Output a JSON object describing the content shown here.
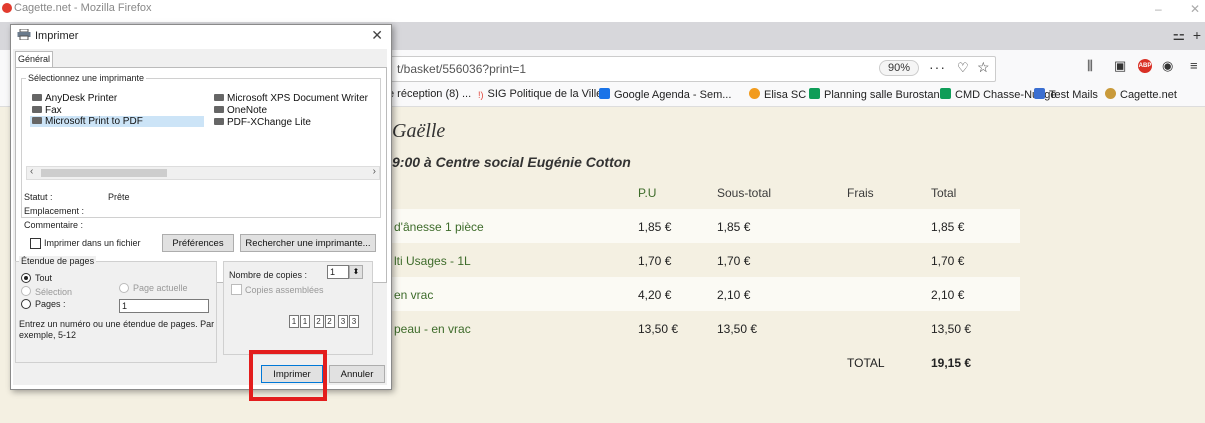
{
  "window": {
    "title": "Cagette.net - Mozilla Firefox"
  },
  "browser": {
    "url": "t/basket/556036?print=1",
    "zoom": "90%",
    "more": "···",
    "bookmarks": [
      {
        "label": "e réception (8) ...",
        "color": "#ffffff"
      },
      {
        "label": "SIG Politique de la Ville",
        "color": "#e0443a"
      },
      {
        "label": "Google Agenda - Sem...",
        "color": "#1a73e8"
      },
      {
        "label": "Elisa SC",
        "color": "#f29b1d"
      },
      {
        "label": "Planning salle Burostan",
        "color": "#0f9d58"
      },
      {
        "label": "CMD Chasse-Nuage",
        "color": "#0f9d58"
      },
      {
        "label": "Test Mails",
        "color": "#3b6fd1"
      },
      {
        "label": "Cagette.net",
        "color": "#c99a3a"
      }
    ]
  },
  "page": {
    "name": "Gaëlle",
    "slot": "9:00 à Centre social Eugénie Cotton",
    "table": {
      "headers": {
        "pu": "P.U",
        "subtotal": "Sous-total",
        "fees": "Frais",
        "total": "Total"
      },
      "rows": [
        {
          "product": "d'ânesse 1 pièce",
          "pu": "1,85 €",
          "subtotal": "1,85 €",
          "fees": "",
          "total": "1,85 €"
        },
        {
          "product": "lti Usages - 1L",
          "pu": "1,70 €",
          "subtotal": "1,70 €",
          "fees": "",
          "total": "1,70 €"
        },
        {
          "product": "en vrac",
          "pu": "4,20 €",
          "subtotal": "2,10 €",
          "fees": "",
          "total": "2,10 €"
        },
        {
          "product": "peau - en vrac",
          "pu": "13,50 €",
          "subtotal": "13,50 €",
          "fees": "",
          "total": "13,50 €"
        }
      ],
      "total_label": "TOTAL",
      "total_value": "19,15 €"
    }
  },
  "dialog": {
    "title": "Imprimer",
    "tab": "Général",
    "printer_group": "Sélectionnez une imprimante",
    "printers": [
      "AnyDesk Printer",
      "Microsoft XPS Document Writer",
      "Fax",
      "OneNote",
      "Microsoft Print to PDF",
      "PDF-XChange Lite"
    ],
    "status_label": "Statut :",
    "status_value": "Prête",
    "location_label": "Emplacement :",
    "comment_label": "Commentaire :",
    "print_to_file": "Imprimer dans un fichier",
    "preferences": "Préférences",
    "find_printer": "Rechercher une imprimante...",
    "range_group": "Étendue de pages",
    "all": "Tout",
    "selection": "Sélection",
    "current_page": "Page actuelle",
    "pages": "Pages :",
    "pages_value": "1",
    "pages_hint": "Entrez un numéro ou une étendue de pages. Par exemple, 5-12",
    "copies_label": "Nombre de copies :",
    "copies_value": "1",
    "collate": "Copies assemblées",
    "print_button": "Imprimer",
    "cancel_button": "Annuler"
  }
}
